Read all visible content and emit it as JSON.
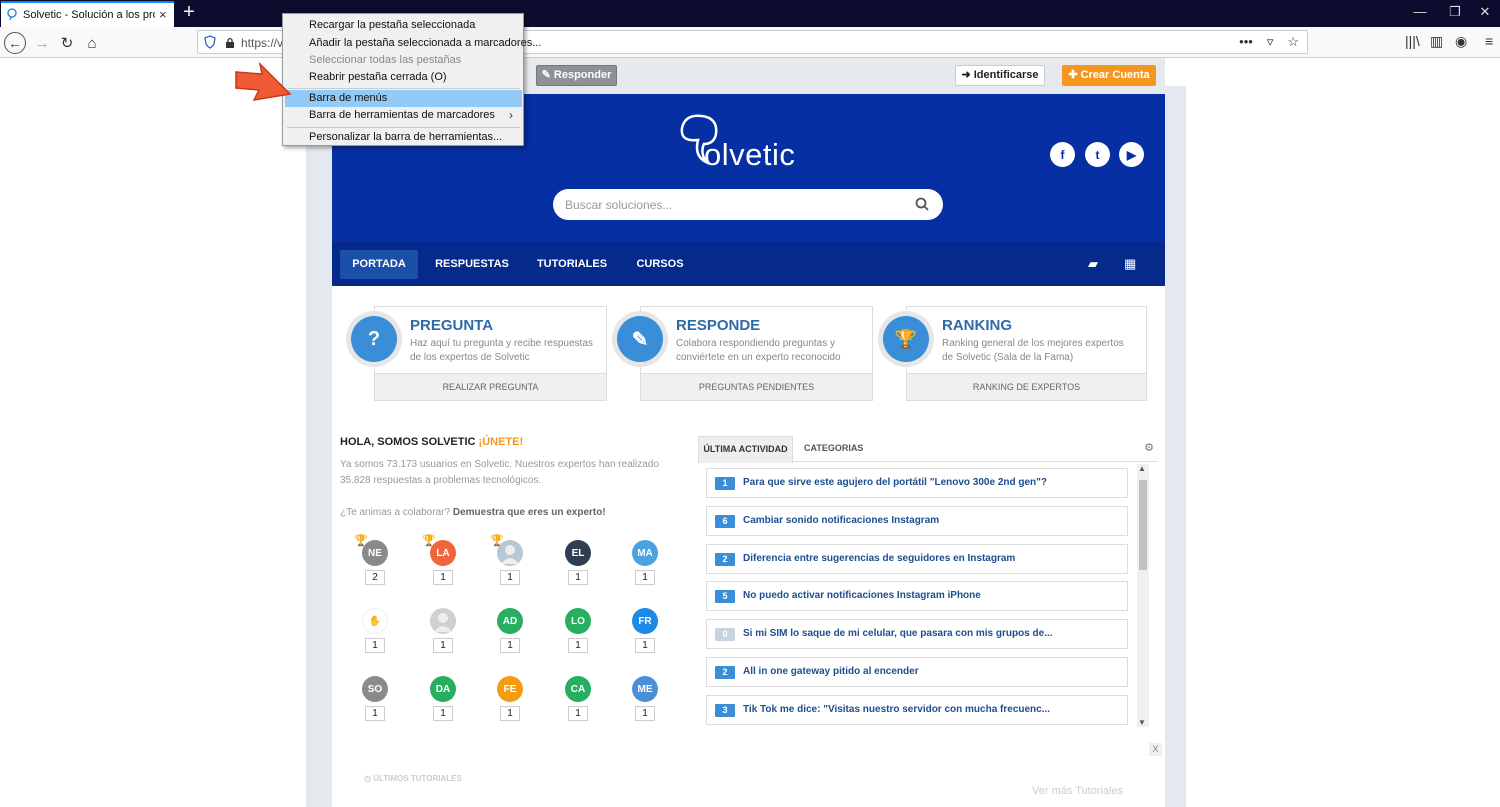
{
  "browser": {
    "tab_title": "Solvetic - Solución a los problem",
    "tab_close": "×",
    "new_tab": "+",
    "url": "https://v",
    "window_controls": [
      "—",
      "❐",
      "✕"
    ]
  },
  "context_menu": {
    "items": [
      {
        "label": "Recargar la pestaña seleccionada",
        "enabled": true
      },
      {
        "label": "Añadir la pestaña seleccionada a marcadores...",
        "enabled": true
      },
      {
        "label": "Seleccionar todas las pestañas",
        "enabled": false
      },
      {
        "label": "Reabrir pestaña cerrada (O)",
        "enabled": true
      },
      {
        "label": "Barra de menús",
        "enabled": true,
        "highlighted": true
      },
      {
        "label": "Barra de herramientas de marcadores",
        "enabled": true,
        "submenu": true
      },
      {
        "label": "Personalizar la barra de herramientas...",
        "enabled": true
      }
    ],
    "submenu_arrow": "›"
  },
  "site": {
    "responder": "Responder",
    "identificarse": "Identificarse",
    "crear_cuenta": "Crear Cuenta",
    "logo_text": "olvetic",
    "search_placeholder": "Buscar soluciones...",
    "social": [
      "f",
      "t",
      "▶"
    ],
    "nav": [
      "PORTADA",
      "RESPUESTAS",
      "TUTORIALES",
      "CURSOS"
    ],
    "cards": [
      {
        "title": "PREGUNTA",
        "desc": "Haz aquí tu pregunta y recibe respuestas de los expertos de Solvetic",
        "footer": "REALIZAR PREGUNTA",
        "icon": "?"
      },
      {
        "title": "RESPONDE",
        "desc": "Colabora respondiendo preguntas y conviértete en un experto reconocido",
        "footer": "PREGUNTAS PENDIENTES",
        "icon": "✎"
      },
      {
        "title": "RANKING",
        "desc": "Ranking general de los mejores expertos de Solvetic (Sala de la Fama)",
        "footer": "RANKING DE EXPERTOS",
        "icon": "🏆"
      }
    ],
    "hola": "HOLA, SOMOS SOLVETIC ",
    "une": "¡ÚNETE!",
    "hola_desc": "Ya somos 73.173 usuarios en Solvetic. Nuestros expertos han realizado 35.828 respuestas a problemas tecnológicos.",
    "anima_q": "¿Te animas a colaborar? ",
    "anima_b": "Demuestra que eres un experto!",
    "users": [
      {
        "initials": "NE",
        "count": "2",
        "color": "#8a8a8a"
      },
      {
        "initials": "LA",
        "count": "1",
        "color": "#f0663c"
      },
      {
        "initials": "",
        "count": "1",
        "color": "#b9c7d3"
      },
      {
        "initials": "EL",
        "count": "1",
        "color": "#2c3e50"
      },
      {
        "initials": "MA",
        "count": "1",
        "color": "#4aa3df"
      },
      {
        "initials": "",
        "count": "1",
        "color": "#ffffff"
      },
      {
        "initials": "",
        "count": "1",
        "color": "#d0d0d0"
      },
      {
        "initials": "AD",
        "count": "1",
        "color": "#27ae60"
      },
      {
        "initials": "LO",
        "count": "1",
        "color": "#27ae60"
      },
      {
        "initials": "FR",
        "count": "1",
        "color": "#1e88e5"
      },
      {
        "initials": "SO",
        "count": "1",
        "color": "#8a8a8a"
      },
      {
        "initials": "DA",
        "count": "1",
        "color": "#27ae60"
      },
      {
        "initials": "FE",
        "count": "1",
        "color": "#f39c12"
      },
      {
        "initials": "CA",
        "count": "1",
        "color": "#27ae60"
      },
      {
        "initials": "ME",
        "count": "1",
        "color": "#4a90d9"
      }
    ],
    "tab_ultima": "ÚLTIMA ACTIVIDAD",
    "tab_categorias": "CATEGORIAS",
    "activity": [
      {
        "n": "1",
        "text": "Para que sirve este agujero del portátil \"Lenovo 300e 2nd gen\"?"
      },
      {
        "n": "6",
        "text": "Cambiar sonido notificaciones Instagram"
      },
      {
        "n": "2",
        "text": "Diferencia entre sugerencias de seguidores en Instagram"
      },
      {
        "n": "5",
        "text": "No puedo activar notificaciones Instagram iPhone"
      },
      {
        "n": "0",
        "text": "Si mi SIM lo saque de mi celular, que pasara con mis grupos de..."
      },
      {
        "n": "2",
        "text": "All in one gateway pitido al encender"
      },
      {
        "n": "3",
        "text": "Tik Tok me dice: \"Visitas nuestro servidor con mucha frecuenc..."
      }
    ],
    "ultimos_tutoriales": "ÚLTIMOS TUTORIALES",
    "ver_mas": "Ver más Tutoriales",
    "close_x": "X"
  }
}
